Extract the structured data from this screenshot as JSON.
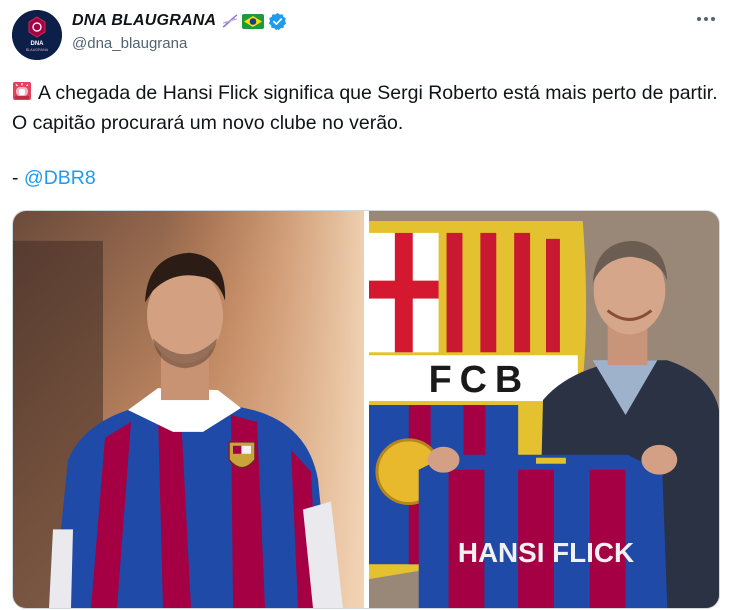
{
  "author": {
    "display_name": "DNA BLAUGRANA",
    "handle": "@dna_blaugrana",
    "avatar_text_top": "DNA",
    "avatar_text_bottom": "BLAUGRANA",
    "icons": [
      "dna-icon",
      "brazil-flag-icon",
      "verified-badge-icon"
    ]
  },
  "tweet": {
    "emoji": "siren-icon",
    "text": "A chegada de Hansi Flick significa que Sergi Roberto está mais perto de partir. O capitão procurará um novo clube no verão.",
    "signature_prefix": "- ",
    "mention": "@DBR8"
  },
  "media": {
    "left_photo": "player-in-striped-shirt-photo",
    "right_photo": "coach-holding-jersey-photo",
    "crest_letters": "FCB",
    "jersey_text": "HANSI FLICK"
  },
  "colors": {
    "text": "#0f1419",
    "secondary_text": "#536471",
    "link": "#1d9bf0",
    "verified": "#1d9bf0",
    "barca_blue": "#1f4aa8",
    "barca_red": "#a50044"
  }
}
